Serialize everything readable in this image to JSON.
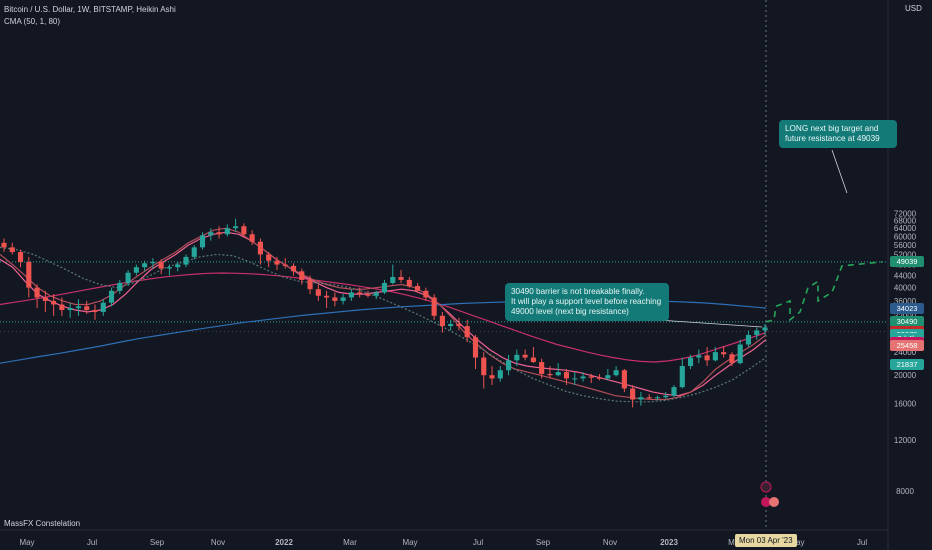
{
  "header": {
    "line1": "Bitcoin / U.S. Dollar, 1W, BITSTAMP, Heikin Ashi",
    "line2": "CMA (50, 1, 80)",
    "currency": "USD"
  },
  "watermark": "MassFX Constelation",
  "cursor_date": "Mon 03 Apr '23",
  "colors": {
    "background": "#131722",
    "up": "#26a69a",
    "down": "#ef5350",
    "ma_blue": "#2e6fb5",
    "ma_red": "#c7306a",
    "level": "#26a69a"
  },
  "annotations": {
    "long_target": "LONG next big target and\nfuture resistance at 49039",
    "barrier": "30490 barrier is not breakable finally.\nIt will play a support level before reaching\n49000 level (next big resistance)"
  },
  "badges": [
    {
      "text": "49039",
      "value": 49039,
      "bg": "#1f8f6f"
    },
    {
      "text": "34023",
      "value": 34023,
      "bg": "#2b5a8c"
    },
    {
      "text": "30490",
      "value": 30490,
      "bg": "#1f8f6f"
    },
    {
      "text": "28301",
      "value": 28301,
      "bg": "#c62828"
    },
    {
      "text": "28075",
      "value": 27650,
      "bg": "#26a69a"
    },
    {
      "text": "3d 4h",
      "value": 26650,
      "bg": "#26a69a"
    },
    {
      "text": "25960",
      "value": 25960,
      "bg": "#c2185b"
    },
    {
      "text": "25458",
      "value": 25300,
      "bg": "#e57373"
    },
    {
      "text": "21837",
      "value": 21837,
      "bg": "#26a69a"
    }
  ],
  "chart_data": {
    "type": "candlestick",
    "title": "Bitcoin / U.S. Dollar, 1W, BITSTAMP, Heikin Ashi",
    "y_axis_label": "USD",
    "y_scale": "log",
    "ylim": [
      7000,
      78000
    ],
    "y_ticks": [
      8000,
      12000,
      16000,
      20000,
      24000,
      28000,
      32000,
      36000,
      40000,
      44000,
      48000,
      52000,
      56000,
      60000,
      64000,
      68000,
      72000
    ],
    "x_ticks": [
      "May",
      "Jul",
      "Sep",
      "Nov",
      "2022",
      "Mar",
      "May",
      "Jul",
      "Sep",
      "Nov",
      "2023",
      "Mar",
      "May",
      "Jul"
    ],
    "grid": false,
    "legend": "top-left",
    "levels": [
      {
        "value": 49039,
        "style": "dotted"
      },
      {
        "value": 30490,
        "style": "dotted"
      }
    ],
    "candles": [
      [
        57000,
        59000,
        53000,
        55000
      ],
      [
        55000,
        57000,
        52000,
        53000
      ],
      [
        53000,
        54000,
        47000,
        49000
      ],
      [
        49000,
        51000,
        37000,
        40000
      ],
      [
        40000,
        41000,
        34000,
        37000
      ],
      [
        37000,
        39000,
        33000,
        36000
      ],
      [
        36000,
        38000,
        32000,
        35000
      ],
      [
        35000,
        37000,
        32000,
        33500
      ],
      [
        33500,
        35500,
        31500,
        34000
      ],
      [
        34000,
        36500,
        32000,
        34500
      ],
      [
        34500,
        36000,
        32500,
        33500
      ],
      [
        33500,
        35000,
        31000,
        33000
      ],
      [
        33000,
        36500,
        32000,
        35500
      ],
      [
        35500,
        40000,
        34500,
        39000
      ],
      [
        39000,
        42500,
        38000,
        41500
      ],
      [
        41500,
        46000,
        40500,
        45000
      ],
      [
        45000,
        48000,
        44000,
        47000
      ],
      [
        47000,
        49500,
        45500,
        48500
      ],
      [
        48500,
        50500,
        46500,
        49000
      ],
      [
        49000,
        50000,
        44500,
        46500
      ],
      [
        46500,
        48000,
        44000,
        47000
      ],
      [
        47000,
        49000,
        45500,
        48000
      ],
      [
        48000,
        52000,
        47000,
        51000
      ],
      [
        51000,
        56000,
        50000,
        55000
      ],
      [
        55000,
        62000,
        54000,
        60500
      ],
      [
        60500,
        64000,
        58000,
        62000
      ],
      [
        62000,
        65000,
        59000,
        61000
      ],
      [
        61000,
        66000,
        60000,
        64000
      ],
      [
        64000,
        69000,
        62000,
        65000
      ],
      [
        65000,
        66500,
        60000,
        61000
      ],
      [
        61000,
        63000,
        56000,
        57500
      ],
      [
        57500,
        59000,
        48000,
        52000
      ],
      [
        52000,
        53000,
        47000,
        49500
      ],
      [
        49500,
        51000,
        46000,
        48000
      ],
      [
        48000,
        50500,
        46500,
        47500
      ],
      [
        47500,
        48500,
        44000,
        45500
      ],
      [
        45500,
        46500,
        41000,
        42500
      ],
      [
        42500,
        44000,
        38000,
        39500
      ],
      [
        39500,
        41000,
        36000,
        37500
      ],
      [
        37500,
        39000,
        34000,
        37000
      ],
      [
        37000,
        38500,
        34500,
        36000
      ],
      [
        36000,
        38000,
        35000,
        37000
      ],
      [
        37000,
        39500,
        36000,
        38500
      ],
      [
        38500,
        40000,
        37000,
        38000
      ],
      [
        38000,
        39000,
        37000,
        37500
      ],
      [
        37500,
        39000,
        36500,
        38500
      ],
      [
        38500,
        42500,
        38000,
        41500
      ],
      [
        41500,
        48000,
        41000,
        43500
      ],
      [
        43500,
        46000,
        41500,
        42500
      ],
      [
        42500,
        43500,
        40000,
        40500
      ],
      [
        40500,
        41500,
        38500,
        39000
      ],
      [
        39000,
        40000,
        36000,
        37000
      ],
      [
        37000,
        38000,
        31000,
        32000
      ],
      [
        32000,
        33000,
        28000,
        29500
      ],
      [
        29500,
        31000,
        28500,
        30000
      ],
      [
        30000,
        31500,
        28500,
        29500
      ],
      [
        29500,
        31000,
        26000,
        27000
      ],
      [
        27000,
        27500,
        21000,
        23000
      ],
      [
        23000,
        24000,
        18000,
        20000
      ],
      [
        20000,
        21500,
        18500,
        19500
      ],
      [
        19500,
        21500,
        19000,
        20800
      ],
      [
        20800,
        23500,
        20000,
        22500
      ],
      [
        22500,
        24500,
        21500,
        23500
      ],
      [
        23500,
        24500,
        22500,
        23000
      ],
      [
        23000,
        25000,
        22000,
        22200
      ],
      [
        22200,
        22800,
        19500,
        20200
      ],
      [
        20200,
        21500,
        19500,
        20000
      ],
      [
        20000,
        22000,
        19800,
        20500
      ],
      [
        20500,
        21000,
        18500,
        19500
      ],
      [
        19500,
        20500,
        18500,
        19500
      ],
      [
        19500,
        20500,
        19000,
        19800
      ],
      [
        19800,
        20200,
        18800,
        19600
      ],
      [
        19600,
        20200,
        19200,
        19500
      ],
      [
        19500,
        21000,
        19200,
        20000
      ],
      [
        20000,
        21500,
        19800,
        20800
      ],
      [
        20800,
        21000,
        17500,
        18000
      ],
      [
        18000,
        18500,
        15500,
        16500
      ],
      [
        16500,
        17500,
        15700,
        16800
      ],
      [
        16800,
        17200,
        16500,
        16700
      ],
      [
        16700,
        17000,
        16400,
        16800
      ],
      [
        16800,
        17500,
        16600,
        17000
      ],
      [
        17000,
        18500,
        16800,
        18200
      ],
      [
        18200,
        23000,
        18000,
        21500
      ],
      [
        21500,
        23500,
        21000,
        23000
      ],
      [
        23000,
        24500,
        22000,
        23400
      ],
      [
        23400,
        25000,
        21500,
        22500
      ],
      [
        22500,
        25000,
        22300,
        24000
      ],
      [
        24000,
        25200,
        23000,
        23600
      ],
      [
        23600,
        24000,
        21500,
        22000
      ],
      [
        22000,
        26500,
        21800,
        25500
      ],
      [
        25500,
        28500,
        25000,
        27500
      ],
      [
        27500,
        29200,
        26500,
        28500
      ],
      [
        28500,
        30000,
        27500,
        29200
      ]
    ],
    "projection": [
      [
        30500,
        31000
      ],
      [
        34500,
        36000
      ],
      [
        31000,
        33000
      ],
      [
        40000,
        42000
      ],
      [
        36000,
        38500
      ],
      [
        47500,
        49039
      ]
    ],
    "ma_series": [
      {
        "color": "#c7306a",
        "values": [
          35000,
          35600,
          36200,
          36900,
          37600,
          38400,
          39200,
          40000,
          40800,
          41600,
          42300,
          43000,
          43600,
          44100,
          44500,
          44800,
          44900,
          44800,
          44600,
          44300,
          43900,
          43400,
          42800,
          42200,
          41600,
          41000,
          40300,
          39600,
          38800,
          37900,
          36900,
          35800,
          34600,
          33300,
          32000,
          30800,
          29600,
          28500,
          27400,
          26400,
          25500,
          24800,
          24100,
          23500,
          23000,
          22600,
          22300,
          22200,
          22400,
          22800,
          23400,
          24200,
          25100,
          26000,
          27000,
          28000
        ]
      },
      {
        "color": "#2e6fb5",
        "values": [
          22000,
          22600,
          23200,
          23800,
          24500,
          25200,
          26000,
          26800,
          27500,
          28200,
          28900,
          29600,
          30300,
          30900,
          31500,
          32100,
          32600,
          33100,
          33600,
          34000,
          34400,
          34700,
          35000,
          35300,
          35500,
          35700,
          35800,
          35900,
          36000,
          36100,
          36100,
          36100,
          36000,
          35900,
          35700,
          35400,
          35000,
          34500,
          34000
        ]
      },
      {
        "color": "#f06292",
        "values": [
          50000,
          47000,
          42000,
          38000,
          36000,
          34500,
          33500,
          33000,
          33500,
          35000,
          38000,
          42000,
          46000,
          49000,
          52000,
          56000,
          59000,
          61000,
          62000,
          61000,
          58000,
          54000,
          50000,
          47000,
          44000,
          42000,
          40000,
          38500,
          38000,
          38000,
          38500,
          39000,
          39500,
          39000,
          37500,
          35000,
          32000,
          29000,
          26500,
          24500,
          23000,
          22000,
          21500,
          21200,
          21000,
          20800,
          20500,
          20000,
          19500,
          19000,
          18500,
          18000,
          17500,
          17200,
          17000,
          17500,
          18500,
          20000,
          21500,
          23000,
          24500,
          26500
        ]
      },
      {
        "color": "#b34e5a",
        "values": [
          52000,
          48000,
          44000,
          40000,
          37500,
          36000,
          35000,
          35000,
          36000,
          38000,
          41000,
          44000,
          47000,
          50000,
          53000,
          57000,
          60000,
          63000,
          64000,
          62000,
          58000,
          54000,
          50000,
          47000,
          44500,
          42500,
          41000,
          40000,
          39500,
          39500,
          40000,
          40500,
          41000,
          40000,
          38000,
          35000,
          31500,
          28000,
          25500,
          23500,
          22000,
          21000,
          20500,
          20000,
          19500,
          19000,
          18500,
          18000,
          17500,
          17000,
          16800,
          16600,
          16500,
          16500,
          16800,
          17500,
          19000,
          21000,
          22500,
          24000,
          25500,
          27500
        ]
      },
      {
        "color": "#5a7a76",
        "dashed": true,
        "values": [
          55000,
          54000,
          52000,
          49000,
          46000,
          43000,
          41000,
          40000,
          41500,
          44000,
          47000,
          49000,
          51000,
          52000,
          51500,
          49000,
          46000,
          43500,
          42000,
          41500,
          41000,
          40000,
          38500,
          36500,
          34500,
          32500,
          30500,
          28500,
          26500,
          24500,
          22500,
          20800,
          19500,
          18500,
          17600,
          17000,
          16600,
          16300,
          16200,
          16200,
          16400,
          16800,
          17400,
          18200,
          19300,
          21000,
          23000
        ]
      }
    ]
  }
}
